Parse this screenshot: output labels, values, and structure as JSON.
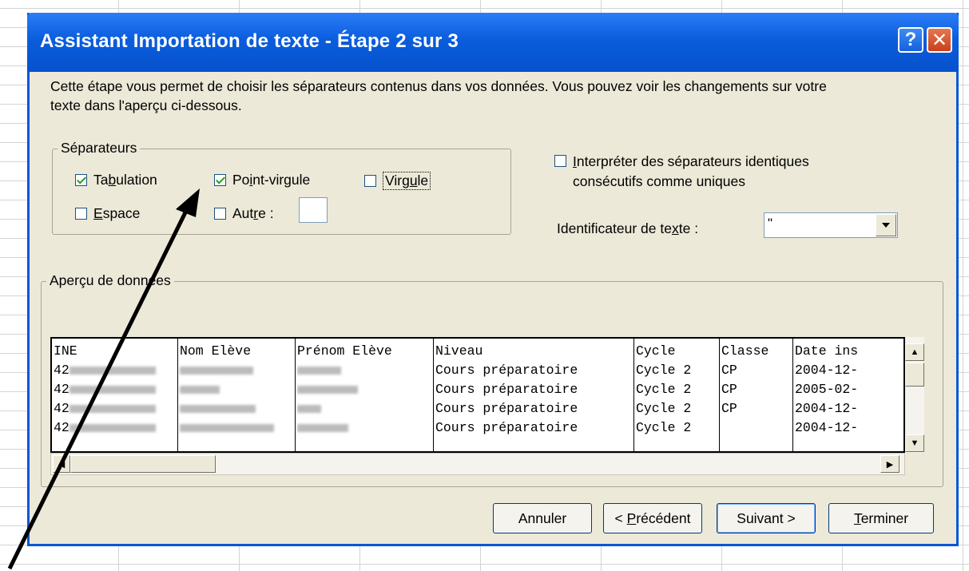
{
  "window": {
    "title": "Assistant Importation de texte - Étape 2 sur 3",
    "help_glyph": "?",
    "close_glyph": "✕"
  },
  "description": "Cette étape vous permet de choisir les séparateurs contenus dans vos données. Vous pouvez voir les changements sur votre texte dans l'aperçu ci-dessous.",
  "separators": {
    "legend": "Séparateurs",
    "tabulation": {
      "pre": "Ta",
      "key": "b",
      "post": "ulation",
      "checked": true
    },
    "point_virgule": {
      "pre": "Po",
      "key": "i",
      "post": "nt-virgule",
      "checked": true
    },
    "virgule": {
      "pre": "Virg",
      "key": "u",
      "post": "le",
      "checked": false
    },
    "espace": {
      "pre": "",
      "key": "E",
      "post": "space",
      "checked": false
    },
    "autre": {
      "pre": "Aut",
      "key": "r",
      "post": "e :",
      "checked": false,
      "value": ""
    }
  },
  "consecutive": {
    "pre": "",
    "key": "I",
    "post": "nterpréter des séparateurs identiques",
    "line2": "consécutifs comme uniques",
    "checked": false
  },
  "text_qualifier": {
    "pre": "Identificateur de te",
    "key": "x",
    "post": "te :",
    "value": "\""
  },
  "preview": {
    "legend": "Aperçu de données",
    "headers": [
      "INE",
      "Nom Elève",
      "Prénom Elève",
      "Niveau",
      "Cycle",
      "Classe",
      "Date ins"
    ],
    "rows": [
      {
        "ine": "42",
        "niveau": "Cours préparatoire",
        "cycle": "Cycle 2",
        "classe": "CP",
        "date": "2004-12-"
      },
      {
        "ine": "42",
        "niveau": "Cours préparatoire",
        "cycle": "Cycle 2",
        "classe": "CP",
        "date": "2005-02-"
      },
      {
        "ine": "42",
        "niveau": "Cours préparatoire",
        "cycle": "Cycle 2",
        "classe": "CP",
        "date": "2004-12-"
      },
      {
        "ine": "42",
        "niveau": "Cours préparatoire",
        "cycle": "Cycle 2",
        "classe": "",
        "date": "2004-12-"
      }
    ]
  },
  "buttons": {
    "annuler": "Annuler",
    "precedent": {
      "pre": "< ",
      "key": "P",
      "post": "récédent"
    },
    "suivant": "Suivant >",
    "terminer": {
      "pre": "",
      "key": "T",
      "post": "erminer"
    }
  },
  "colors": {
    "title_bar": "#0a5ddd",
    "dialog_bg": "#ece9d8",
    "check": "#21a121"
  }
}
